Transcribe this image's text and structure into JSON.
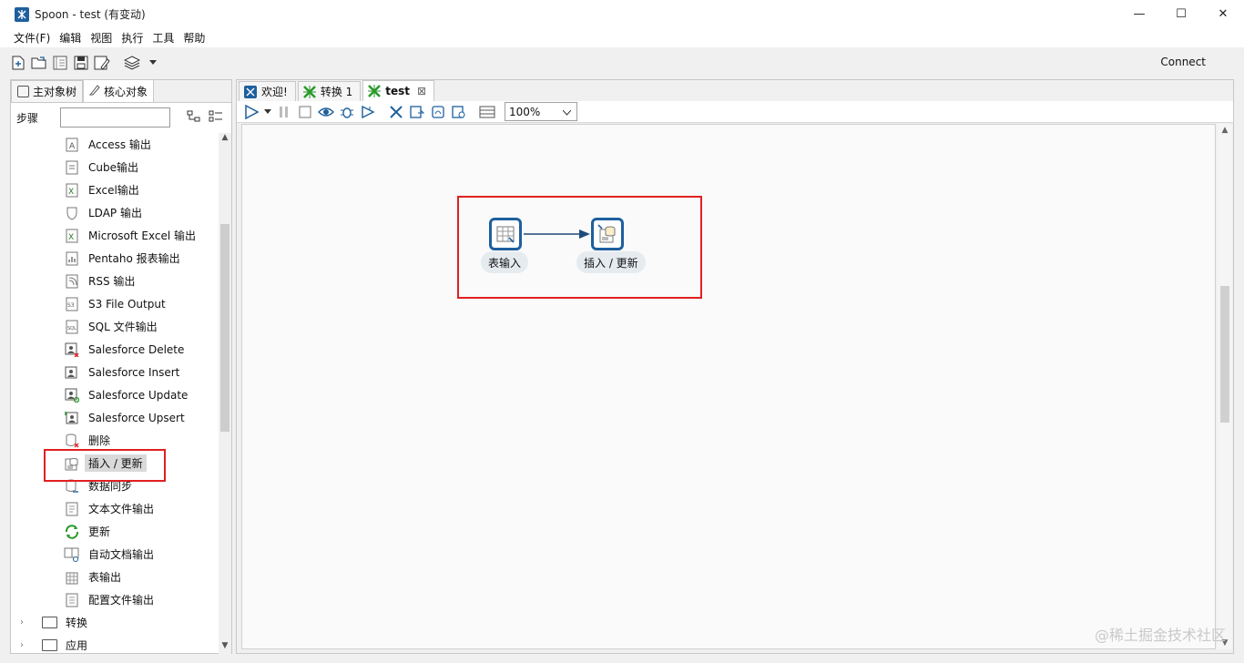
{
  "window": {
    "title": "Spoon - test (有变动)",
    "min": "—",
    "max": "☐",
    "close": "✕"
  },
  "menu": [
    "文件(F)",
    "编辑",
    "视图",
    "执行",
    "工具",
    "帮助"
  ],
  "toolbar": {
    "connect": "Connect"
  },
  "left": {
    "tabs": [
      "主对象树",
      "核心对象"
    ],
    "step_label": "步骤",
    "step_value": "",
    "items": [
      {
        "label": "Access 输出",
        "icon": "access-output-icon"
      },
      {
        "label": "Cube输出",
        "icon": "cube-output-icon"
      },
      {
        "label": "Excel输出",
        "icon": "excel-output-icon"
      },
      {
        "label": "LDAP 输出",
        "icon": "ldap-output-icon"
      },
      {
        "label": "Microsoft Excel 输出",
        "icon": "ms-excel-output-icon"
      },
      {
        "label": "Pentaho 报表输出",
        "icon": "pentaho-report-icon"
      },
      {
        "label": "RSS 输出",
        "icon": "rss-output-icon"
      },
      {
        "label": "S3 File Output",
        "icon": "s3-output-icon"
      },
      {
        "label": "SQL 文件输出",
        "icon": "sql-file-output-icon"
      },
      {
        "label": "Salesforce Delete",
        "icon": "salesforce-delete-icon"
      },
      {
        "label": "Salesforce Insert",
        "icon": "salesforce-insert-icon"
      },
      {
        "label": "Salesforce Update",
        "icon": "salesforce-update-icon"
      },
      {
        "label": "Salesforce Upsert",
        "icon": "salesforce-upsert-icon"
      },
      {
        "label": "删除",
        "icon": "delete-icon"
      },
      {
        "label": "插入 / 更新",
        "icon": "insert-update-icon"
      },
      {
        "label": "数据同步",
        "icon": "sync-icon"
      },
      {
        "label": "文本文件输出",
        "icon": "text-file-output-icon"
      },
      {
        "label": "更新",
        "icon": "update-icon"
      },
      {
        "label": "自动文档输出",
        "icon": "autodoc-icon"
      },
      {
        "label": "表输出",
        "icon": "table-output-icon"
      },
      {
        "label": "配置文件输出",
        "icon": "config-file-output-icon"
      }
    ],
    "folders": [
      "转换",
      "应用"
    ]
  },
  "right": {
    "tabs": [
      {
        "label": "欢迎!"
      },
      {
        "label": "转换 1"
      },
      {
        "label": "test"
      }
    ],
    "tab_close": "⊠",
    "zoom": "100%",
    "nodes": [
      {
        "label": "表输入"
      },
      {
        "label": "插入 / 更新"
      }
    ]
  },
  "watermark": "@稀土掘金技术社区",
  "colors": {
    "accent": "#1e5f9e",
    "highlight": "#e02020"
  }
}
